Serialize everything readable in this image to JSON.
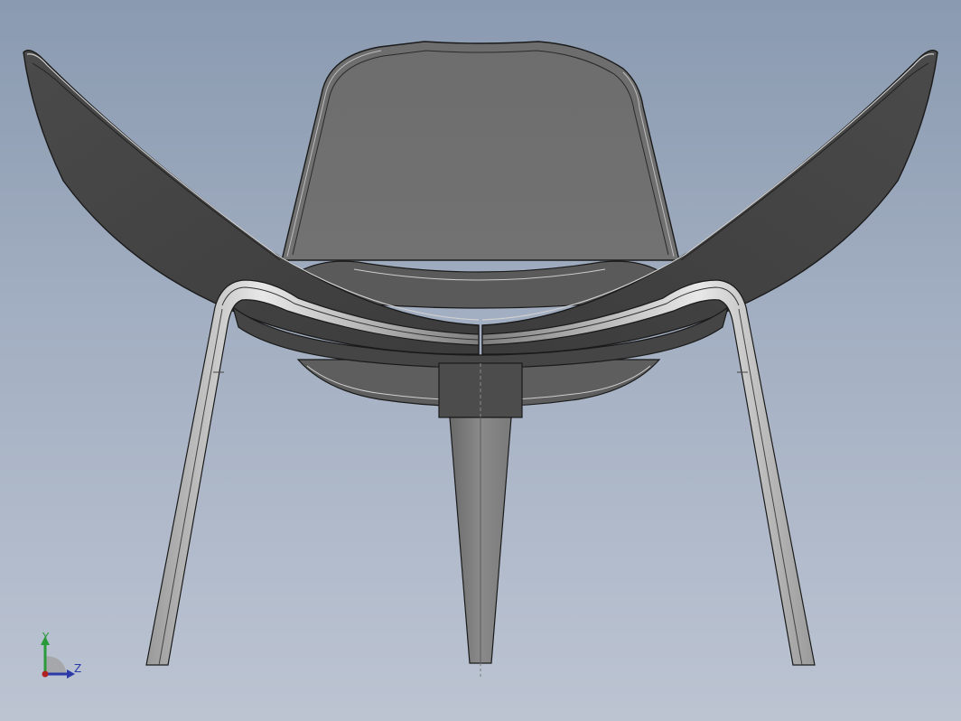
{
  "viewport": {
    "background_top": "#8a9ab0",
    "background_bottom": "#bcc4d2",
    "model_name": "shell-lounge-chair",
    "view": "front",
    "render_mode": "shaded-with-edges"
  },
  "colors": {
    "shell_dark": "#4a4a4a",
    "shell_mid": "#6a6a6a",
    "seat_face": "#707070",
    "edge_line": "#1a1a1a",
    "leg_highlight": "#e6e6e6",
    "leg_shade": "#8c8c8c",
    "center_leg": "#7c7c7c"
  },
  "triad": {
    "y_label": "Y",
    "z_label": "Z",
    "y_color": "#2a9a3a",
    "z_color": "#2a3aa8",
    "origin_color": "#b02020",
    "icons": [
      "axis-y-arrow-icon",
      "axis-z-arrow-icon",
      "axis-origin-icon"
    ]
  }
}
